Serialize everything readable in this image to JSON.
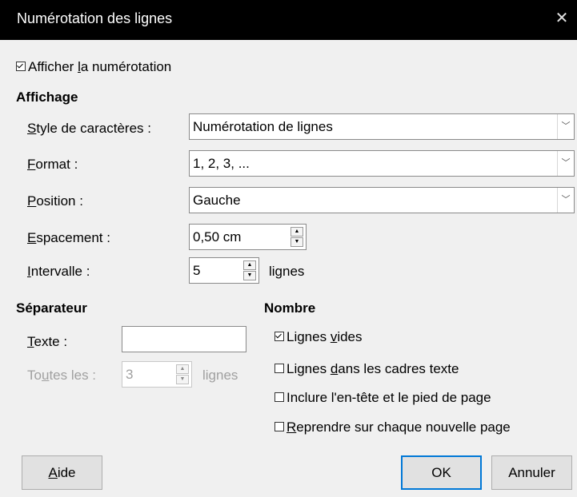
{
  "dialog": {
    "title": "Numérotation des lignes"
  },
  "show_numbering": {
    "before": "Afficher ",
    "u": "l",
    "after": "a numérotation",
    "checked": true
  },
  "affichage": {
    "heading": "Affichage",
    "char_style": {
      "u": "S",
      "rest": "tyle de caractères :",
      "value": "Numérotation de lignes"
    },
    "format": {
      "u": "F",
      "rest": "ormat :",
      "value": "1, 2, 3, ..."
    },
    "position": {
      "u": "P",
      "rest": "osition :",
      "value": "Gauche"
    },
    "spacing": {
      "u": "E",
      "rest": "spacement :",
      "value": "0,50 cm"
    },
    "interval": {
      "u": "I",
      "rest": "ntervalle :",
      "value": "5",
      "unit": "lignes"
    }
  },
  "separator": {
    "heading": "Séparateur",
    "text": {
      "u": "T",
      "rest": "exte :",
      "value": ""
    },
    "every": {
      "before": "To",
      "u": "u",
      "after": "tes les :",
      "value": "3",
      "unit": "lignes"
    }
  },
  "count": {
    "heading": "Nombre",
    "blank_lines": {
      "before": "Lignes ",
      "u": "v",
      "after": "ides",
      "checked": true
    },
    "text_frames": {
      "before": "Lignes ",
      "u": "d",
      "after": "ans les cadres texte",
      "checked": false
    },
    "header_footer": {
      "label": "Inclure l'en-tête et le pied de page",
      "checked": false
    },
    "restart": {
      "before": "",
      "u": "R",
      "after": "eprendre sur chaque nouvelle page",
      "checked": false
    }
  },
  "buttons": {
    "help": {
      "u": "A",
      "rest": "ide"
    },
    "ok": "OK",
    "cancel": "Annuler"
  },
  "icons": {
    "close": "close-icon",
    "dropdown": "chevron-down-icon",
    "spin_up": "spin-up-icon",
    "spin_down": "spin-down-icon"
  }
}
